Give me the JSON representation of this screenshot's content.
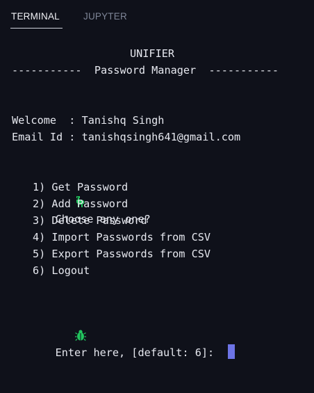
{
  "tabs": {
    "terminal": "TERMINAL",
    "jupyter": "JUPYTER"
  },
  "terminal": {
    "app_name": "UNIFIER",
    "subtitle_line": "-----------  Password Manager  -----------",
    "welcome_line": "Welcome  : Tanishq Singh",
    "email_line": "Email Id : tanishqsingh641@gmail.com",
    "choose_prompt": "Choose any one?",
    "options": [
      "1) Get Password",
      "2) Add Password",
      "3) Delete Password",
      "4) Import Passwords from CSV",
      "5) Export Passwords from CSV",
      "6) Logout"
    ],
    "input_prompt": "Enter here, [default: 6]:"
  },
  "icons": {
    "choose_icon": "dinosaur-icon",
    "input_icon": "bug-icon"
  },
  "colors": {
    "background": "#0f111a",
    "text": "#e6e8ef",
    "tab_inactive": "#7e8597",
    "icon_green": "#22c55e",
    "cursor": "#6d74e6"
  }
}
